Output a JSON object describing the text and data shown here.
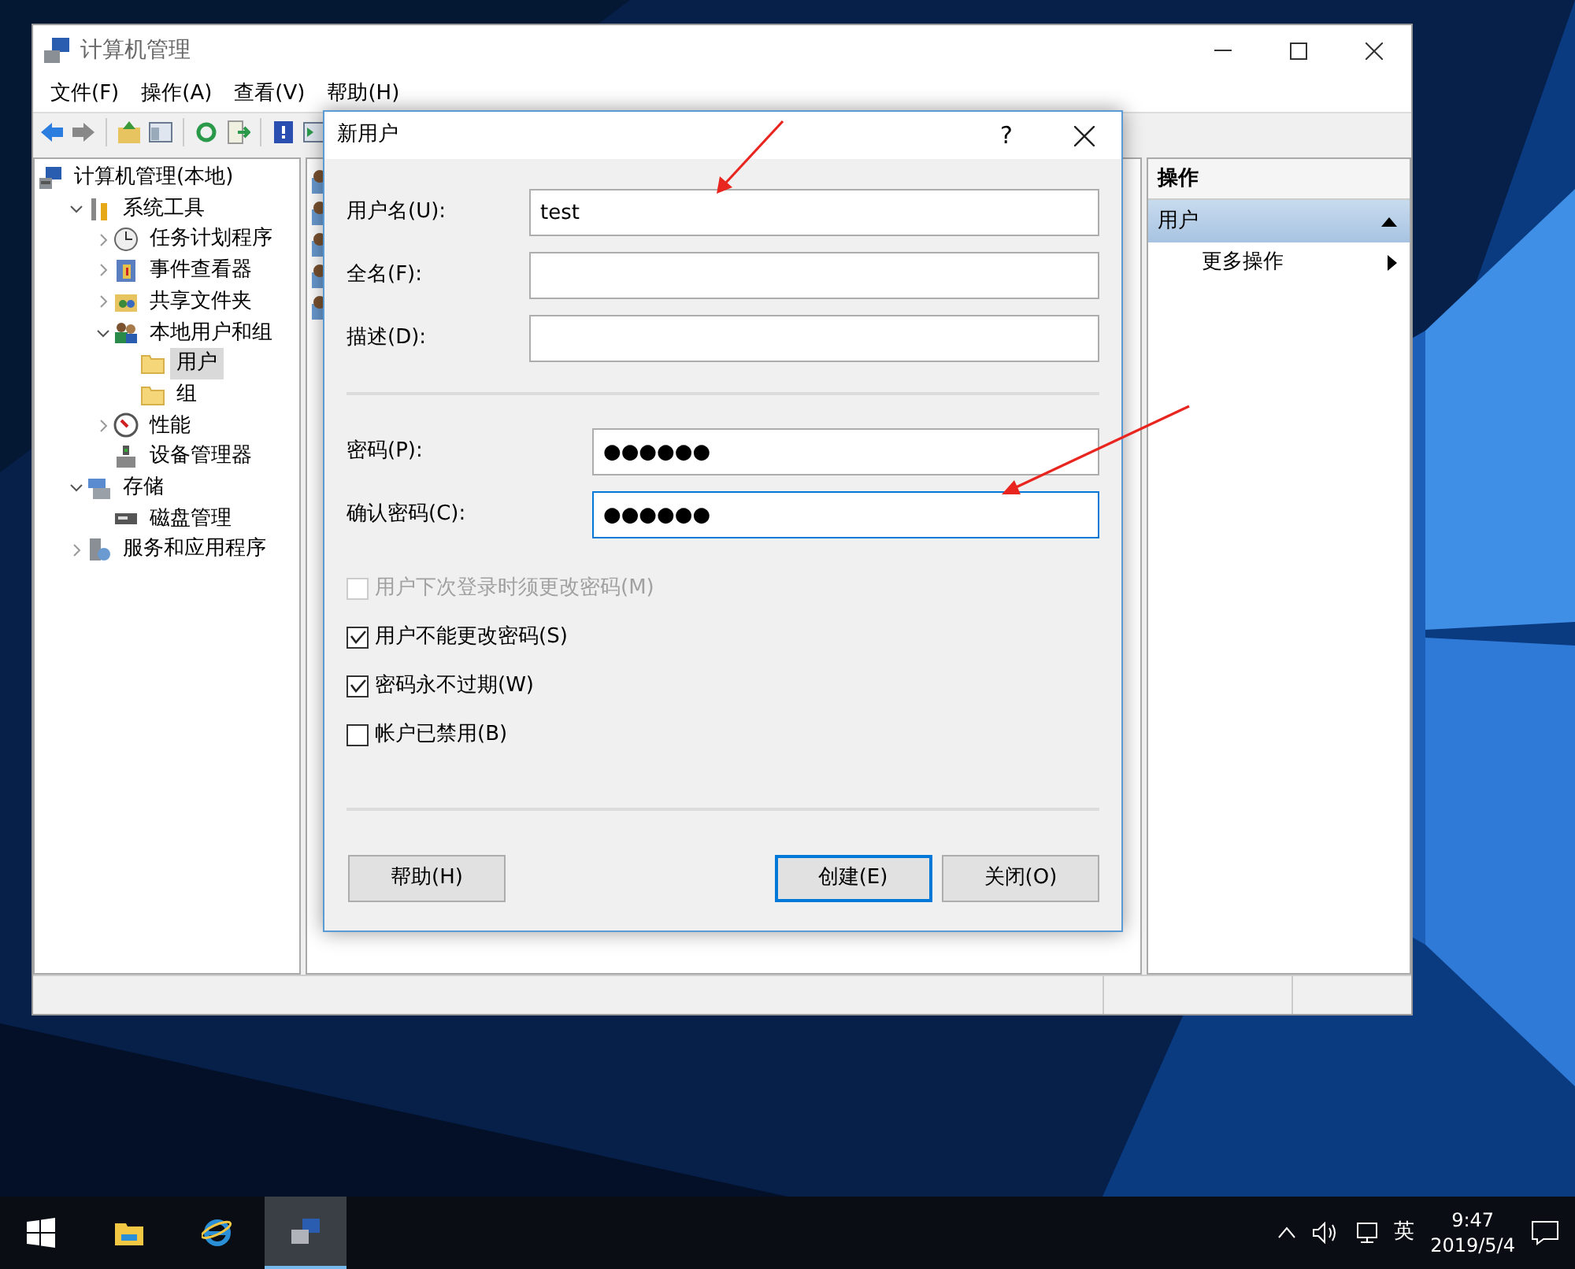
{
  "window": {
    "title": "计算机管理",
    "menu": [
      "文件(F)",
      "操作(A)",
      "查看(V)",
      "帮助(H)"
    ]
  },
  "tree": [
    {
      "label": "计算机管理(本地)",
      "kind": "computer",
      "selected": false,
      "children": [
        {
          "label": "系统工具",
          "kind": "tools",
          "expanded": true,
          "selected": false,
          "children": [
            {
              "label": "任务计划程序",
              "kind": "clock",
              "expanded": false,
              "selected": false
            },
            {
              "label": "事件查看器",
              "kind": "log",
              "expanded": false,
              "selected": false
            },
            {
              "label": "共享文件夹",
              "kind": "share",
              "expanded": false,
              "selected": false
            },
            {
              "label": "本地用户和组",
              "kind": "users",
              "expanded": true,
              "selected": false,
              "children": [
                {
                  "label": "用户",
                  "kind": "folder",
                  "selected": true
                },
                {
                  "label": "组",
                  "kind": "folder",
                  "selected": false
                }
              ]
            },
            {
              "label": "性能",
              "kind": "gauge",
              "expanded": false,
              "selected": false
            },
            {
              "label": "设备管理器",
              "kind": "device",
              "selected": false
            }
          ]
        },
        {
          "label": "存储",
          "kind": "storage",
          "expanded": true,
          "selected": false,
          "children": [
            {
              "label": "磁盘管理",
              "kind": "disk",
              "selected": false
            }
          ]
        },
        {
          "label": "服务和应用程序",
          "kind": "services",
          "expanded": false,
          "selected": false
        }
      ]
    }
  ],
  "actions": {
    "title": "操作",
    "section": "用户",
    "expanded": true,
    "items": [
      "更多操作"
    ]
  },
  "dialog": {
    "title": "新用户",
    "help_glyph": "?",
    "fields": [
      {
        "label": "用户名(U):",
        "value": "test",
        "kind": "account",
        "focused": false
      },
      {
        "label": "全名(F):",
        "kind": "account",
        "focused": false
      },
      {
        "label": "描述(D):",
        "kind": "account",
        "focused": false
      },
      {
        "label": "密码(P):",
        "value": "●●●●●●",
        "kind": "password",
        "focused": false
      },
      {
        "label": "确认密码(C):",
        "value": "●●●●●●",
        "kind": "password",
        "focused": true
      }
    ],
    "checkboxes": [
      {
        "label": "用户下次登录时须更改密码(M)",
        "checked": false,
        "disabled": true
      },
      {
        "label": "用户不能更改密码(S)",
        "checked": true,
        "disabled": false
      },
      {
        "label": "密码永不过期(W)",
        "checked": true,
        "disabled": false
      },
      {
        "label": "帐户已禁用(B)",
        "checked": false,
        "disabled": false
      }
    ],
    "buttons": [
      {
        "label": "帮助(H)",
        "default": false
      },
      {
        "label": "创建(E)",
        "default": true
      },
      {
        "label": "关闭(O)",
        "default": false
      }
    ]
  },
  "taskbar": {
    "buttons": [
      {
        "kind": "start",
        "active": false
      },
      {
        "kind": "explorer",
        "active": false
      },
      {
        "kind": "browser",
        "active": false
      },
      {
        "kind": "management",
        "active": true
      }
    ],
    "tray": {
      "ime": "英",
      "time": "9:47",
      "date": "2019/5/4"
    }
  }
}
